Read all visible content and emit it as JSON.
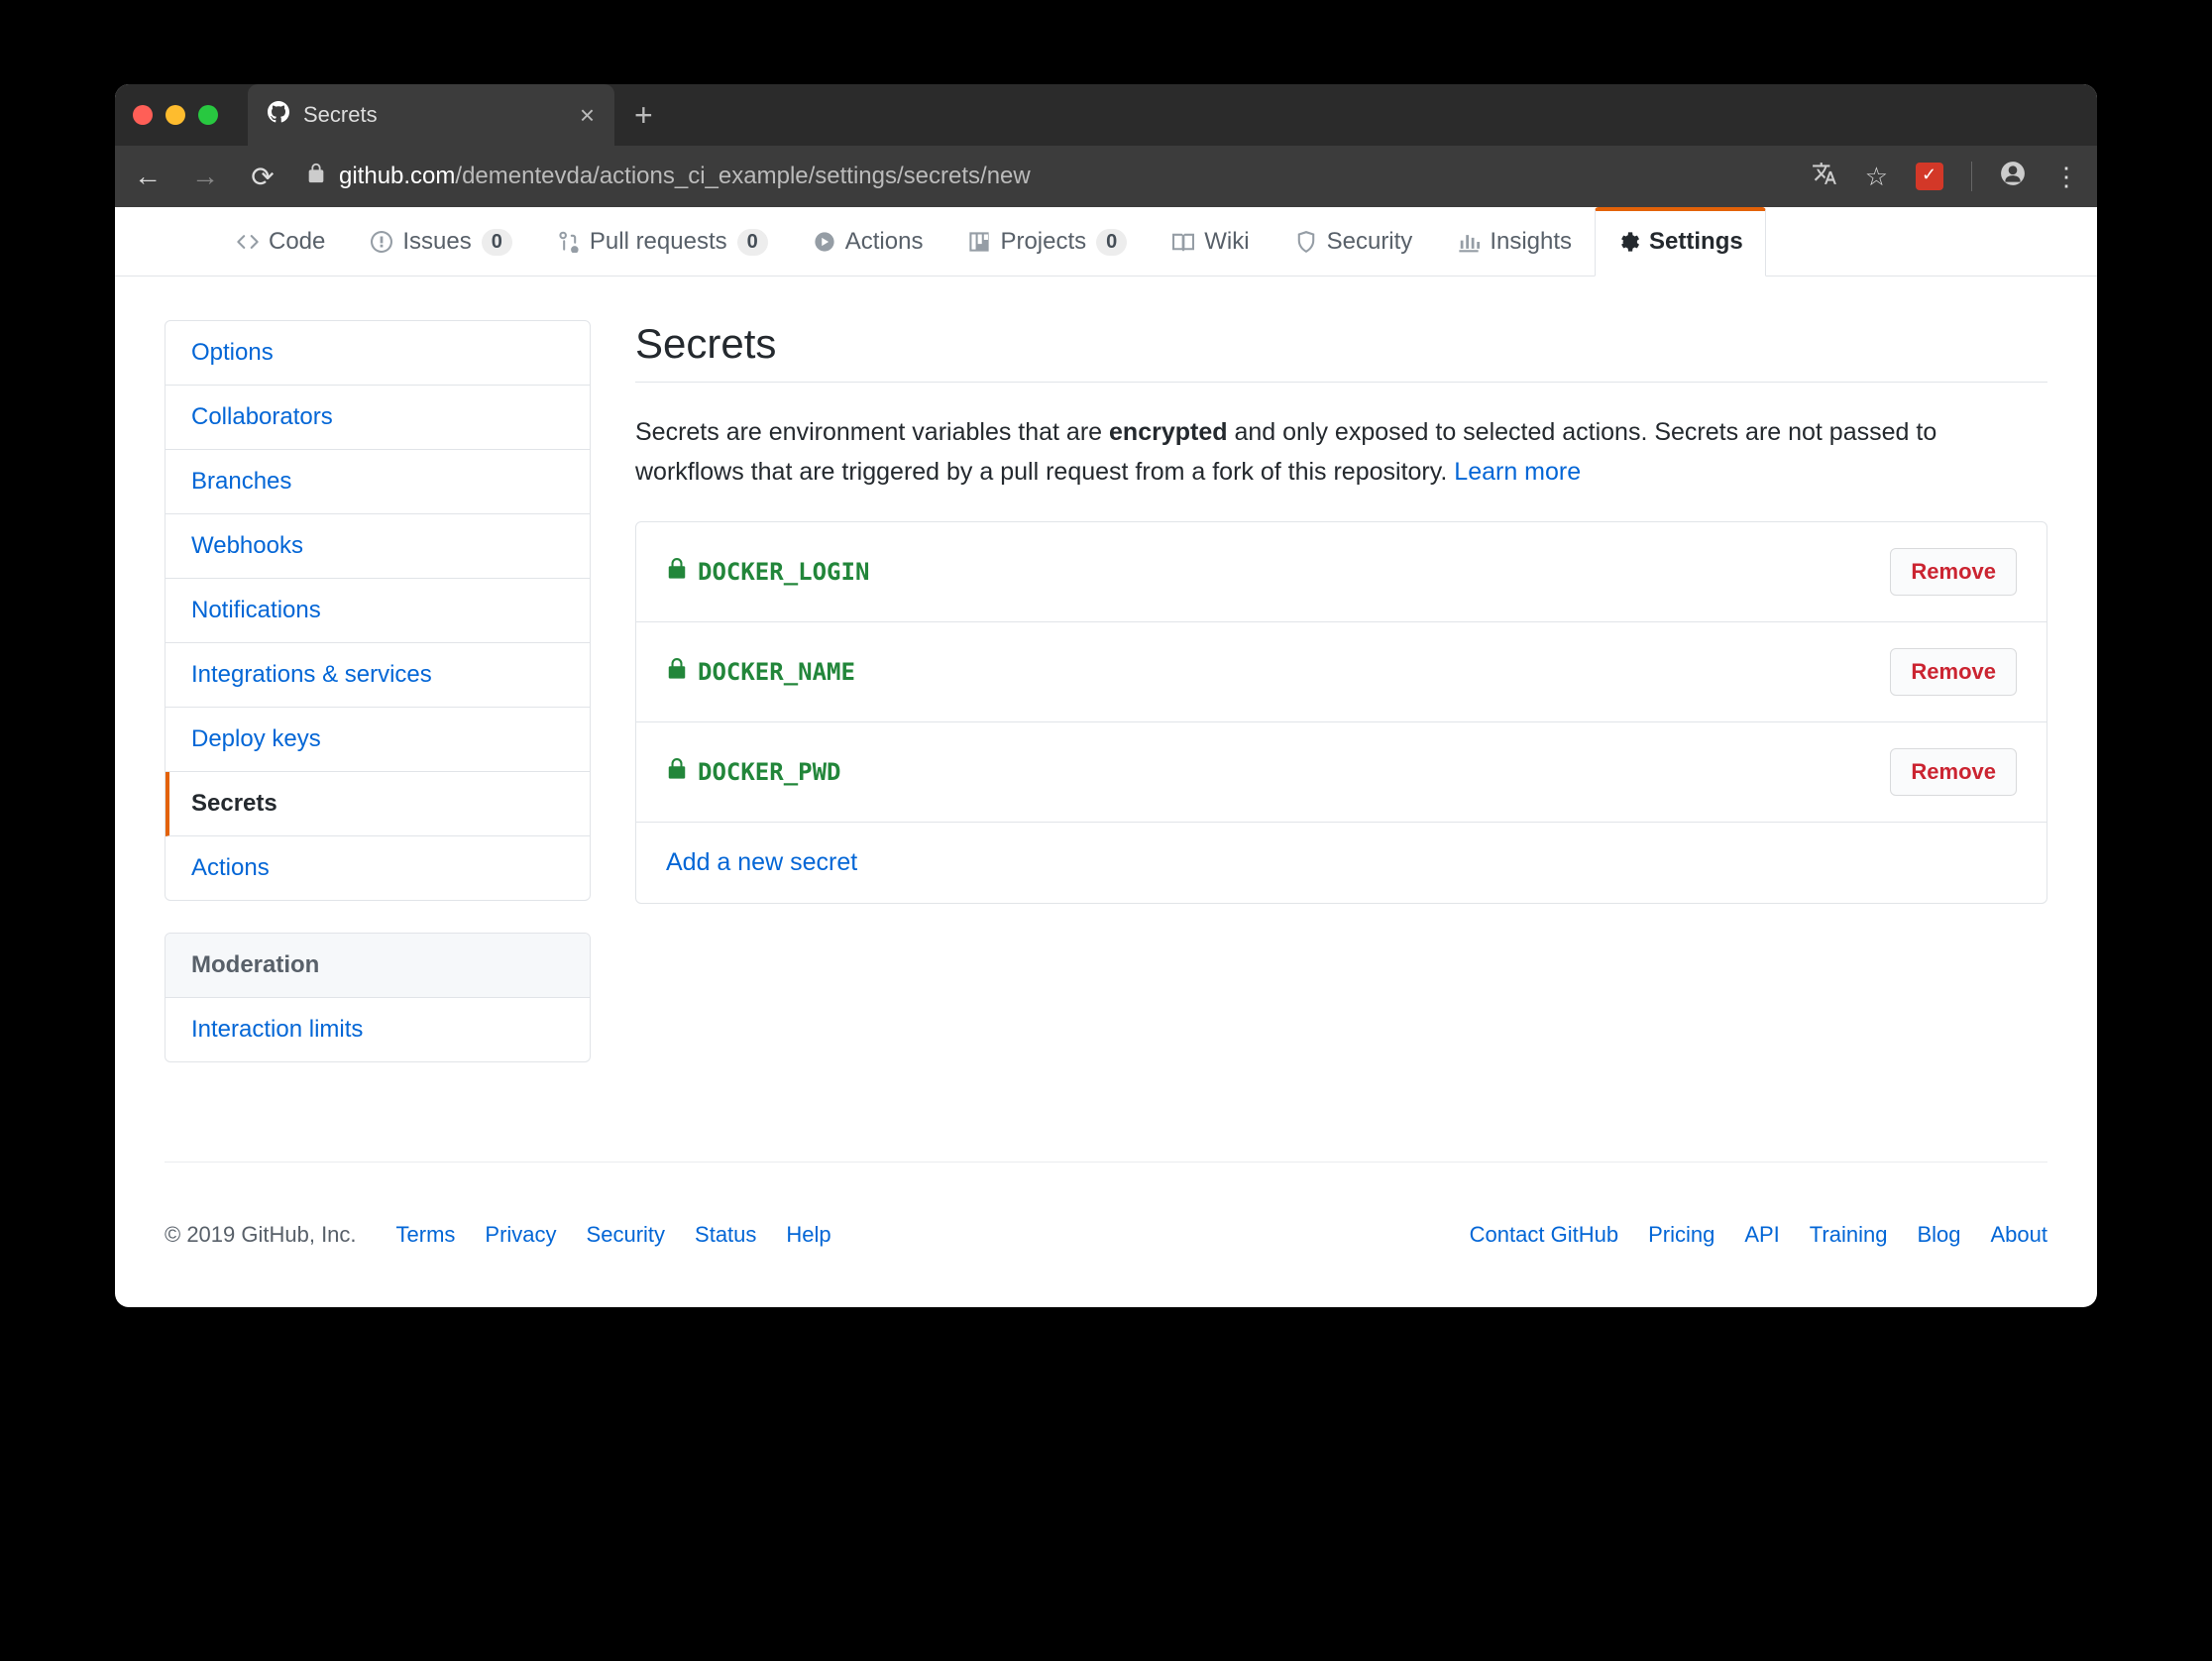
{
  "browser": {
    "tab_title": "Secrets",
    "url_host": "github.com",
    "url_path": "/dementevda/actions_ci_example/settings/secrets/new"
  },
  "repo_tabs": {
    "code": "Code",
    "issues": {
      "label": "Issues",
      "count": "0"
    },
    "pulls": {
      "label": "Pull requests",
      "count": "0"
    },
    "actions": "Actions",
    "projects": {
      "label": "Projects",
      "count": "0"
    },
    "wiki": "Wiki",
    "security": "Security",
    "insights": "Insights",
    "settings": "Settings"
  },
  "sidebar": {
    "items": [
      "Options",
      "Collaborators",
      "Branches",
      "Webhooks",
      "Notifications",
      "Integrations & services",
      "Deploy keys",
      "Secrets",
      "Actions"
    ],
    "moderation_header": "Moderation",
    "moderation_items": [
      "Interaction limits"
    ]
  },
  "page": {
    "title": "Secrets",
    "desc_1": "Secrets are environment variables that are ",
    "desc_bold": "encrypted",
    "desc_2": " and only exposed to selected actions. Secrets are not passed to workflows that are triggered by a pull request from a fork of this repository. ",
    "learn_more": "Learn more"
  },
  "secrets": [
    {
      "name": "DOCKER_LOGIN",
      "remove": "Remove"
    },
    {
      "name": "DOCKER_NAME",
      "remove": "Remove"
    },
    {
      "name": "DOCKER_PWD",
      "remove": "Remove"
    }
  ],
  "add_secret": "Add a new secret",
  "footer": {
    "copyright": "© 2019 GitHub, Inc.",
    "left": [
      "Terms",
      "Privacy",
      "Security",
      "Status",
      "Help"
    ],
    "right": [
      "Contact GitHub",
      "Pricing",
      "API",
      "Training",
      "Blog",
      "About"
    ]
  }
}
